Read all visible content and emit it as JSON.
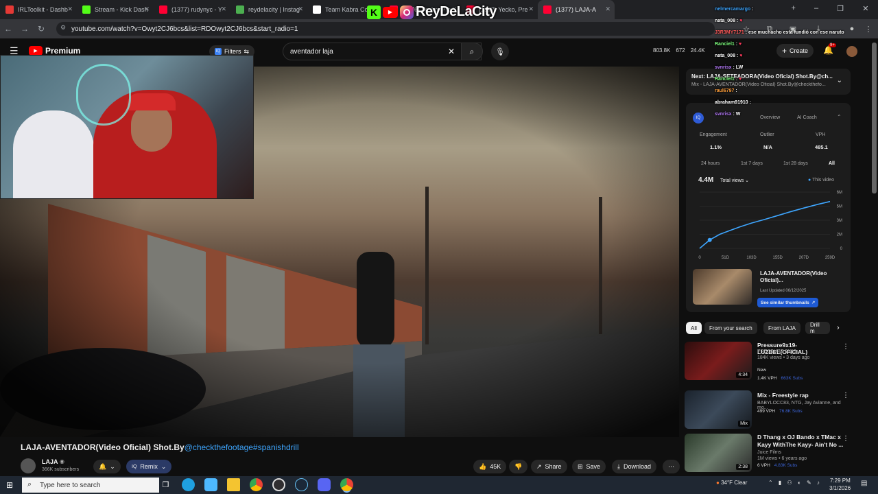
{
  "browser": {
    "tabs": [
      {
        "title": "IRLToolkit - Dashb",
        "color": "#e53935"
      },
      {
        "title": "Stream - Kick Dash",
        "color": "#53fc18"
      },
      {
        "title": "(1377) rudynyc - Y",
        "color": "#ff0033"
      },
      {
        "title": "reydelacity | Instag",
        "color": "#4caf50"
      },
      {
        "title": "Team Kabra Co",
        "color": "#ffffff"
      },
      {
        "title": "(1376) Yecko, Pre",
        "color": "#ff0033"
      },
      {
        "title": "(1377) Yecko, Pre",
        "color": "#ff0033"
      },
      {
        "title": "(1377) LAJA-A",
        "color": "#ff0033"
      }
    ],
    "url": "youtube.com/watch?v=Owyt2CJ6bcs&list=RDOwyt2CJ6bcs&start_radio=1",
    "stream_logo_text": "ReyDeLaCity"
  },
  "youtube": {
    "brand": "Premium",
    "filters_label": "Filters",
    "search_query": "aventador laja",
    "stats": {
      "views": "803.8K",
      "other": "672",
      "subs": "24.4K"
    },
    "create_label": "Create",
    "notif_count": "9+"
  },
  "video": {
    "title_main": "LAJA-AVENTADOR(Video Oficial) Shot.By",
    "title_tags": "@checkthefootage#spanishdrill",
    "channel": "LAJA",
    "subscribers": "366K subscribers",
    "remix_label": "Remix",
    "likes": "45K",
    "share_label": "Share",
    "save_label": "Save",
    "download_label": "Download"
  },
  "next_card": {
    "title": "Next: LAJA-SETEADORA(Video Oficial) Shot.By@ch...",
    "subtitle": "Mix - LAJA-AVENTADOR(Video Oficial) Shot.By@checkthefo..."
  },
  "vidiq": {
    "tabs": [
      "Overview",
      "AI Coach"
    ],
    "metrics": [
      {
        "label": "Engagement",
        "value": "1.1%"
      },
      {
        "label": "Outlier",
        "value": "N/A"
      },
      {
        "label": "VPH",
        "value": "485.1"
      }
    ],
    "ranges": [
      "24 hours",
      "1st 7 days",
      "1st 28 days",
      "All"
    ],
    "total_views": "4.4M",
    "views_select": "Total views",
    "legend": "This video",
    "similar_title": "LAJA-AVENTADOR(Video Oficial)...",
    "last_updated": "Last Updated 06/12/2025",
    "similar_btn": "See similar thumbnails"
  },
  "chart_data": {
    "type": "line",
    "x_ticks": [
      "0",
      "51D",
      "103D",
      "155D",
      "207D",
      "259D"
    ],
    "y_ticks": [
      "0",
      "2M",
      "3M",
      "5M",
      "6M"
    ],
    "series": [
      {
        "x": [
          0,
          20,
          40,
          60,
          80,
          103,
          130,
          155,
          180,
          207,
          235,
          259
        ],
        "y": [
          0.0,
          0.9,
          1.5,
          1.9,
          2.3,
          2.7,
          3.1,
          3.5,
          3.9,
          4.3,
          4.7,
          5.0
        ]
      }
    ],
    "ylim": [
      0,
      6
    ],
    "xlim": [
      0,
      259
    ],
    "color": "#3ea6ff"
  },
  "chips": [
    "All",
    "From your search",
    "From LAJA",
    "Drill m"
  ],
  "recommendations": [
    {
      "title": "Pressure9x19-LUZBEL(OFICIAL)",
      "channel": "PRESSURE 9X19",
      "views": "184K views • 3 days ago",
      "badge_new": "New",
      "vph": "1.4K VPH",
      "subs": "663K Subs",
      "duration": "4:34",
      "thumb": "#7a1c1c"
    },
    {
      "title": "Mix - Freestyle rap",
      "channel": "BABYLOCC83, NTG, Jay Avianne, and mo...",
      "views": "",
      "badge_new": "",
      "vph": "499 VPH",
      "subs": "76.8K Subs",
      "duration": "Mix",
      "thumb": "#2a3440"
    },
    {
      "title": "D Thang x OJ Bando x TMac x Kayy WithThe Kayy- Ain't No ...",
      "channel": "Juice Films",
      "views": "1M views • 6 years ago",
      "badge_new": "",
      "vph": "6 VPH",
      "subs": "4.83K Subs",
      "duration": "2:38",
      "thumb": "#4a5a4a"
    }
  ],
  "chat": [
    {
      "user": "nelmercamargo",
      "msg": "",
      "color": "#3ea6ff"
    },
    {
      "user": "nata_008",
      "msg": "♥",
      "color": "#ffffff"
    },
    {
      "user": "J3R3MY7171",
      "msg": "ese muchacho esta fundió con ese naruto",
      "color": "#ff5a5a"
    },
    {
      "user": "Ranciel1",
      "msg": "♥",
      "color": "#7fff7f"
    },
    {
      "user": "nata_008",
      "msg": "♥",
      "color": "#ffffff"
    },
    {
      "user": "svnrisx",
      "msg": "LW",
      "color": "#b97dff"
    },
    {
      "user": "Ranciel1",
      "msg": "♥",
      "color": "#7fff7f"
    },
    {
      "user": "raul6797",
      "msg": "",
      "color": "#ff9f3b"
    },
    {
      "user": "abraham91910",
      "msg": "",
      "color": "#ffffff"
    },
    {
      "user": "svnrisx",
      "msg": "W",
      "color": "#b97dff"
    }
  ],
  "taskbar": {
    "search_placeholder": "Type here to search",
    "weather": "34°F  Clear",
    "time": "7:29 PM",
    "date": "3/1/2026"
  }
}
